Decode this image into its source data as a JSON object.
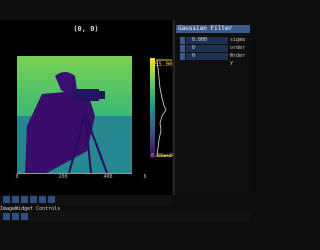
{
  "plot": {
    "title": "(0, 0)",
    "ticks": [
      "0",
      "200",
      "400",
      "6"
    ],
    "hist_max": "255.00",
    "hist_min": "0.00e+00"
  },
  "panel": {
    "title": "Gaussian Filter",
    "rows": [
      {
        "value": "0.000",
        "label": "sigma"
      },
      {
        "value": "0",
        "label": "order x"
      },
      {
        "value": "0",
        "label": "order y"
      }
    ]
  },
  "controls": {
    "title": "ImageWidget Controls"
  },
  "colors": {
    "accent": "#3c5e8f",
    "viridis_low": "#440154",
    "viridis_mid": "#21918c",
    "viridis_high": "#fde725"
  }
}
